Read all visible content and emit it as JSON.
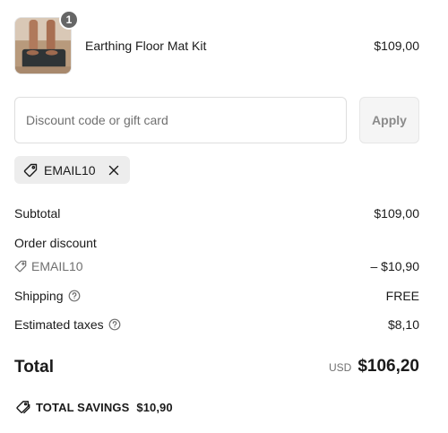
{
  "product": {
    "quantity": "1",
    "name": "Earthing Floor Mat Kit",
    "price": "$109,00",
    "image_alt": "product-photo"
  },
  "discount": {
    "placeholder": "Discount code or gift card",
    "value": "",
    "apply_label": "Apply",
    "applied_code": "EMAIL10"
  },
  "summary": {
    "subtotal_label": "Subtotal",
    "subtotal_value": "$109,00",
    "order_discount_label": "Order discount",
    "discount_code": "EMAIL10",
    "discount_value": "– $10,90",
    "shipping_label": "Shipping",
    "shipping_value": "FREE",
    "taxes_label": "Estimated taxes",
    "taxes_value": "$8,10",
    "total_label": "Total",
    "currency": "USD",
    "total_value": "$106,20",
    "savings_label": "TOTAL SAVINGS",
    "savings_value": "$10,90"
  },
  "icons": {
    "tag": "tag-icon",
    "close": "close-icon",
    "help": "help-circle-icon",
    "savings": "tags-icon"
  },
  "colors": {
    "text": "#1a1a1a",
    "muted": "#707070",
    "badge": "#666666",
    "chip_bg": "#ededed",
    "border": "#dedede"
  }
}
